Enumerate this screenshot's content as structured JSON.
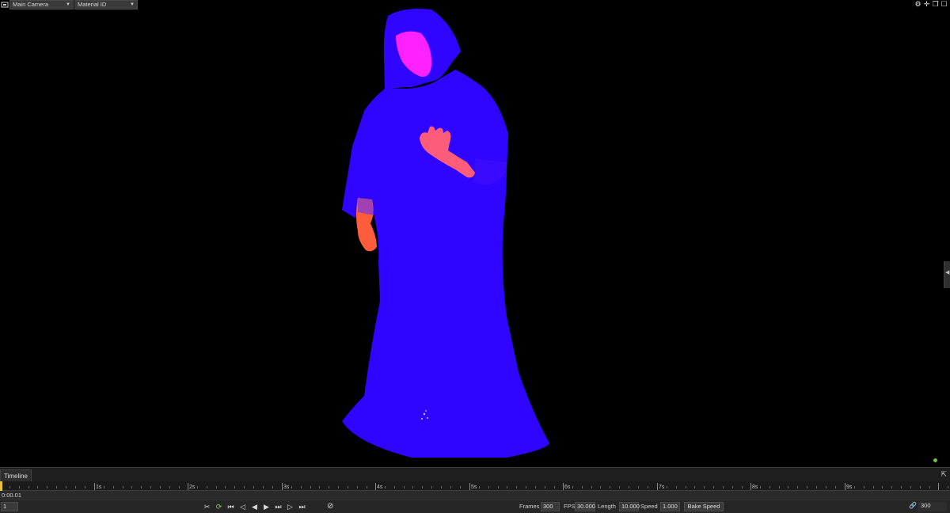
{
  "viewport": {
    "camera_select": "Main Camera",
    "render_mode_select": "Material ID",
    "controls": [
      "gear-icon",
      "move-icon",
      "restore-icon",
      "maximize-icon"
    ],
    "colors": {
      "robe": "#2f05ff",
      "skin_face": "#ff22ff",
      "skin_hand": "#ff5c4c",
      "background": "#000000",
      "status": "#6fc23a"
    }
  },
  "timeline": {
    "tab_label": "Timeline",
    "ruler_labels": [
      "1s",
      "2s",
      "3s",
      "4s",
      "5s",
      "6s",
      "7s",
      "8s",
      "9s"
    ],
    "timecode": "0:00.01",
    "current_frame": "1",
    "frames_label": "Frames",
    "frames_value": "300",
    "fps_label": "FPS",
    "fps_value": "30.000",
    "length_label": "Length",
    "length_value": "10.000",
    "speed_label": "Speed",
    "speed_value": "1.000",
    "bake_button": "Bake Speed",
    "end_frame": "300"
  }
}
